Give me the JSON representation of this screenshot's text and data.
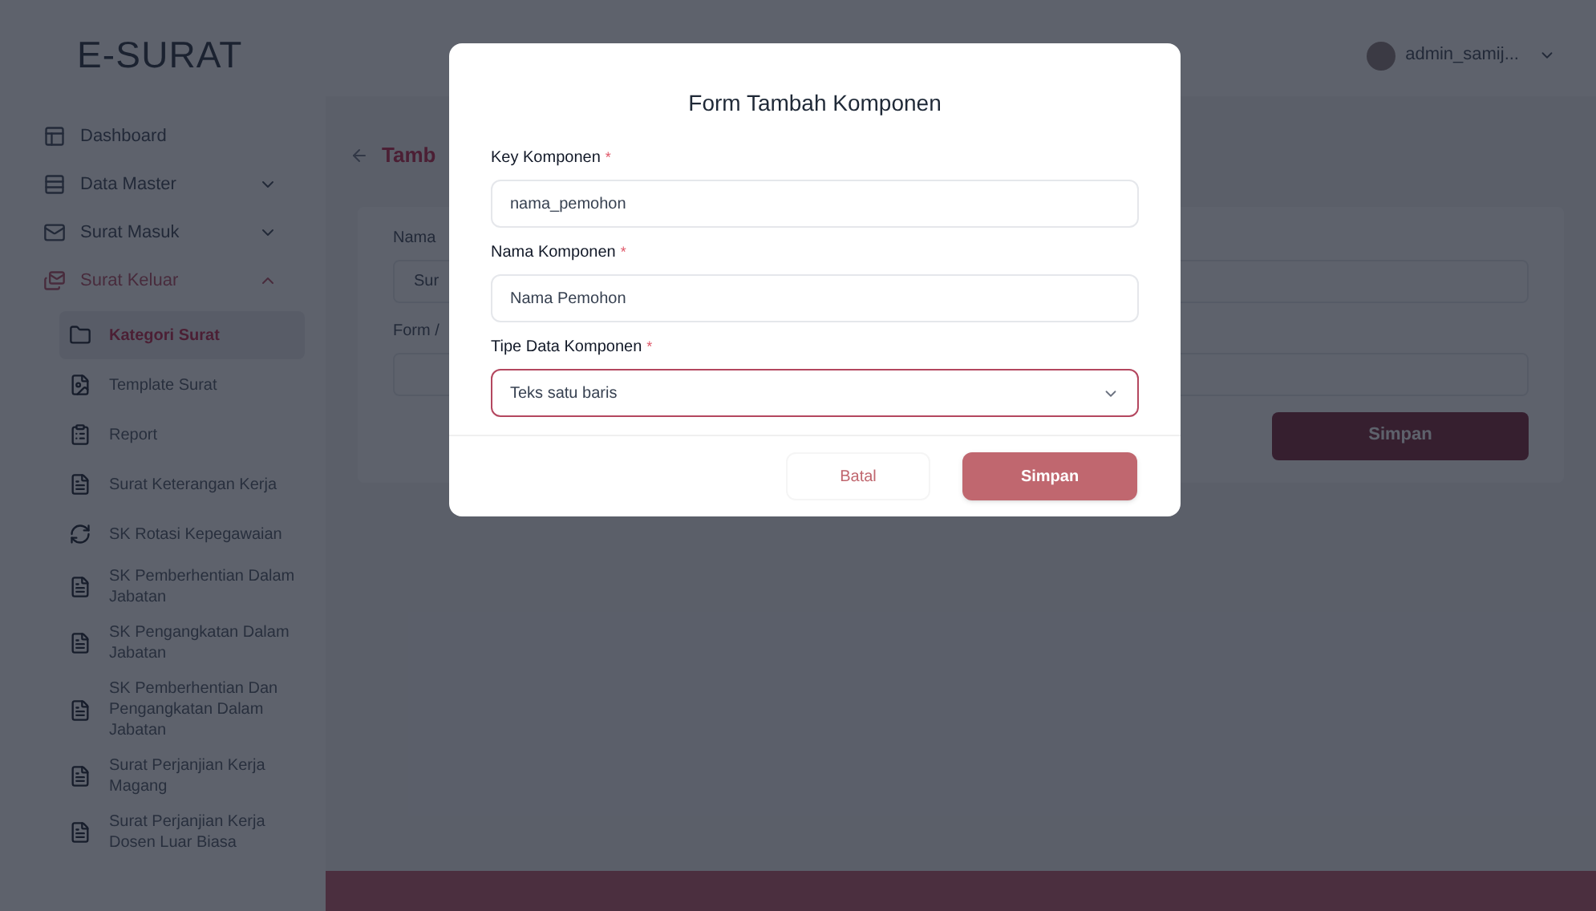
{
  "header": {
    "brand": "E-SURAT",
    "user": "admin_samij..."
  },
  "sidebar": {
    "items": [
      {
        "kind": "link",
        "label": "Dashboard",
        "selected": false
      },
      {
        "kind": "group",
        "label": "Data Master",
        "selected": false,
        "expanded": false
      },
      {
        "kind": "group",
        "label": "Surat Masuk",
        "selected": false,
        "expanded": false
      },
      {
        "kind": "group",
        "label": "Surat Keluar",
        "selected": true,
        "expanded": true,
        "children": [
          {
            "label": "Kategori Surat",
            "selected": true
          },
          {
            "label": "Template Surat",
            "selected": false
          },
          {
            "label": "Report",
            "selected": false
          },
          {
            "label": "Surat Keterangan Kerja",
            "selected": false
          },
          {
            "label": "SK Rotasi Kepegawaian",
            "selected": false
          },
          {
            "label": "SK Pemberhentian Dalam Jabatan",
            "selected": false
          },
          {
            "label": "SK Pengangkatan Dalam Jabatan",
            "selected": false
          },
          {
            "label": "SK Pemberhentian Dan Pengangkatan Dalam Jabatan",
            "selected": false
          },
          {
            "label": "Surat Perjanjian Kerja Magang",
            "selected": false
          },
          {
            "label": "Surat Perjanjian Kerja Dosen Luar Biasa",
            "selected": false
          }
        ]
      }
    ]
  },
  "page": {
    "title": "Tamb",
    "fields": [
      {
        "label": "Nama",
        "value": "Sur"
      },
      {
        "label": "Form /"
      }
    ],
    "save_button": "Simpan"
  },
  "modal": {
    "title": "Form Tambah Komponen",
    "fields": [
      {
        "kind": "text",
        "label": "Key Komponen",
        "required_mark": "*",
        "value": "nama_pemohon",
        "focused": false
      },
      {
        "kind": "text",
        "label": "Nama Komponen",
        "required_mark": "*",
        "value": "Nama Pemohon",
        "focused": false
      },
      {
        "kind": "select",
        "label": "Tipe Data Komponen",
        "required_mark": "*",
        "value": "Teks satu baris",
        "focused": true
      }
    ],
    "buttons": [
      {
        "kind": "secondary",
        "label": "Batal"
      },
      {
        "kind": "primary",
        "label": "Simpan"
      }
    ]
  }
}
